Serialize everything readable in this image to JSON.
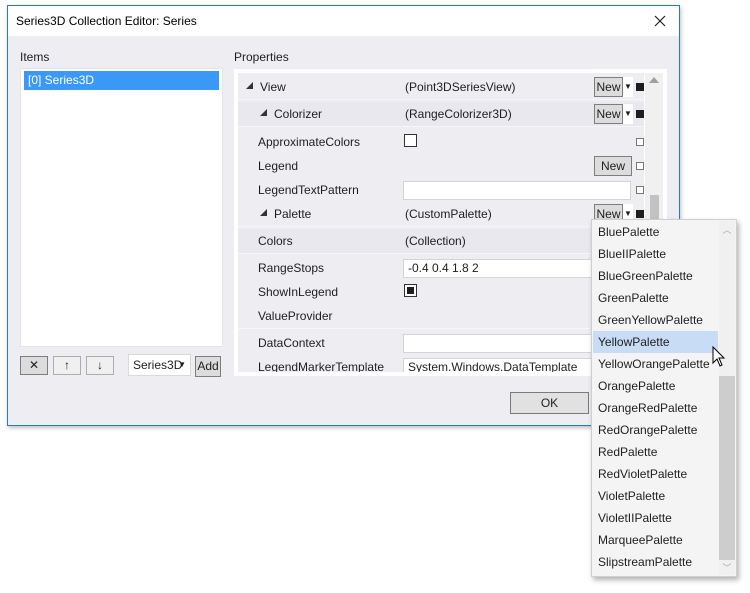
{
  "dialog": {
    "title": "Series3D Collection Editor: Series",
    "close_icon": "close-icon"
  },
  "items_panel": {
    "label": "Items",
    "items": [
      {
        "label": "[0] Series3D",
        "selected": true
      }
    ],
    "buttons": {
      "remove_icon": "✕",
      "move_up_icon": "↑",
      "move_down_icon": "↓"
    },
    "type_combo": {
      "value": "Series3D"
    },
    "add_label": "Add"
  },
  "properties_panel": {
    "label": "Properties",
    "rows": [
      {
        "name": "View",
        "expandable": true,
        "value": "(Point3DSeriesView)",
        "new_button": "New",
        "has_dropdown": true,
        "marker": "filled"
      },
      {
        "name": "Colorizer",
        "expandable": true,
        "value": "(RangeColorizer3D)",
        "new_button": "New",
        "has_dropdown": true,
        "marker": "filled"
      },
      {
        "name": "ApproximateColors",
        "checkbox": false,
        "marker": "empty"
      },
      {
        "name": "Legend",
        "new_button": "New",
        "marker": "empty"
      },
      {
        "name": "LegendTextPattern",
        "textbox": "",
        "marker": "empty"
      },
      {
        "name": "Palette",
        "expandable": true,
        "value": "(CustomPalette)",
        "new_button": "New",
        "has_dropdown": true,
        "marker": "filled"
      },
      {
        "name": "Colors",
        "value": "(Collection)"
      },
      {
        "name": "RangeStops",
        "textbox": "-0.4 0.4 1.8 2"
      },
      {
        "name": "ShowInLegend",
        "checkbox": true
      },
      {
        "name": "ValueProvider"
      },
      {
        "name": "DataContext",
        "textbox": ""
      },
      {
        "name": "LegendMarkerTemplate",
        "textbox": "System.Windows.DataTemplate"
      }
    ]
  },
  "footer": {
    "ok_label": "OK"
  },
  "palette_dropdown": {
    "selected": "YellowPalette",
    "options": [
      "BluePalette",
      "BlueIIPalette",
      "BlueGreenPalette",
      "GreenPalette",
      "GreenYellowPalette",
      "YellowPalette",
      "YellowOrangePalette",
      "OrangePalette",
      "OrangeRedPalette",
      "RedOrangePalette",
      "RedPalette",
      "RedVioletPalette",
      "VioletPalette",
      "VioletIIPalette",
      "MarqueePalette",
      "SlipstreamPalette"
    ]
  },
  "colors": {
    "selection_blue": "#3c98f7",
    "dropdown_highlight": "#c8dcf5",
    "window_border": "#2b79c2"
  }
}
